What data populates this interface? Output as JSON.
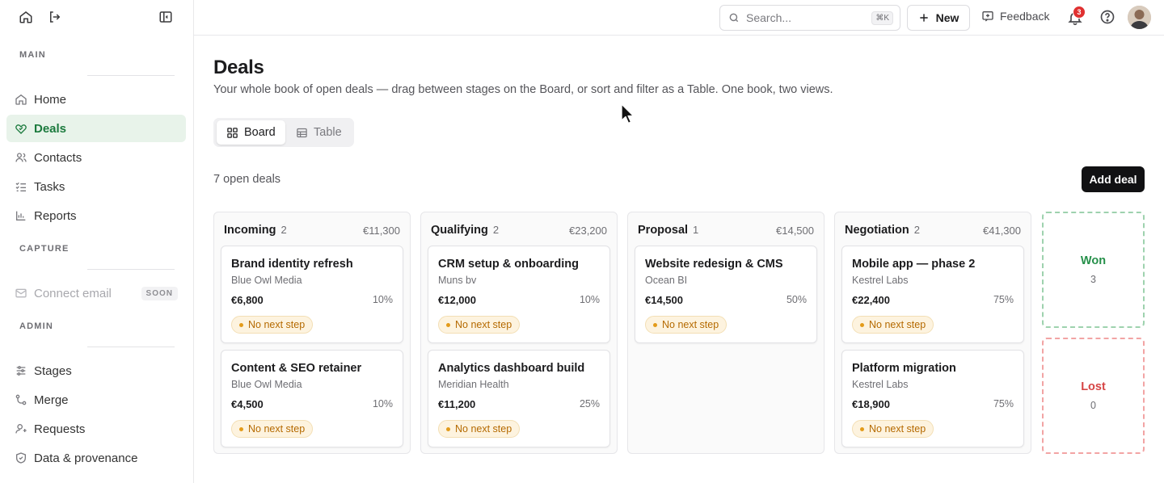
{
  "sidebar": {
    "sections": {
      "main": "MAIN",
      "capture": "CAPTURE",
      "admin": "ADMIN"
    },
    "items": [
      {
        "label": "Home",
        "icon": "home-icon"
      },
      {
        "label": "Deals",
        "icon": "deals-icon",
        "active": true
      },
      {
        "label": "Contacts",
        "icon": "contacts-icon"
      },
      {
        "label": "Tasks",
        "icon": "tasks-icon"
      },
      {
        "label": "Reports",
        "icon": "reports-icon"
      },
      {
        "label": "Connect email",
        "icon": "mail-icon",
        "badge": "SOON",
        "disabled": true
      },
      {
        "label": "Stages",
        "icon": "stages-icon"
      },
      {
        "label": "Merge",
        "icon": "merge-icon"
      },
      {
        "label": "Requests",
        "icon": "requests-icon"
      },
      {
        "label": "Data & provenance",
        "icon": "shield-icon"
      }
    ]
  },
  "topbar": {
    "search_placeholder": "Search...",
    "search_shortcut": "⌘K",
    "new_label": "New",
    "feedback_label": "Feedback",
    "notification_count": "3"
  },
  "page": {
    "title": "Deals",
    "subtitle": "Your whole book of open deals — drag between stages on the Board, or sort and filter as a Table. One book, two views.",
    "views": [
      "Board",
      "Table"
    ],
    "active_view": "Board",
    "open_count": "7 open deals",
    "add_deal_label": "Add deal"
  },
  "board": {
    "columns": [
      {
        "name": "Incoming",
        "count": "2",
        "total": "€11,300",
        "cards": [
          {
            "title": "Brand identity refresh",
            "company": "Blue Owl Media",
            "value": "€6,800",
            "probability": "10%",
            "status": "No next step"
          },
          {
            "title": "Content & SEO retainer",
            "company": "Blue Owl Media",
            "value": "€4,500",
            "probability": "10%",
            "status": "No next step"
          }
        ]
      },
      {
        "name": "Qualifying",
        "count": "2",
        "total": "€23,200",
        "cards": [
          {
            "title": "CRM setup & onboarding",
            "company": "Muns bv",
            "value": "€12,000",
            "probability": "10%",
            "status": "No next step"
          },
          {
            "title": "Analytics dashboard build",
            "company": "Meridian Health",
            "value": "€11,200",
            "probability": "25%",
            "status": "No next step"
          }
        ]
      },
      {
        "name": "Proposal",
        "count": "1",
        "total": "€14,500",
        "cards": [
          {
            "title": "Website redesign & CMS",
            "company": "Ocean BI",
            "value": "€14,500",
            "probability": "50%",
            "status": "No next step"
          }
        ]
      },
      {
        "name": "Negotiation",
        "count": "2",
        "total": "€41,300",
        "cards": [
          {
            "title": "Mobile app — phase 2",
            "company": "Kestrel Labs",
            "value": "€22,400",
            "probability": "75%",
            "status": "No next step"
          },
          {
            "title": "Platform migration",
            "company": "Kestrel Labs",
            "value": "€18,900",
            "probability": "75%",
            "status": "No next step"
          }
        ]
      }
    ],
    "outcomes": {
      "won": {
        "label": "Won",
        "count": "3",
        "color": "#26904a"
      },
      "lost": {
        "label": "Lost",
        "count": "0",
        "color": "#d64545"
      }
    }
  },
  "colors": {
    "accent": "#1b7a3d",
    "active_bg": "#e8f3ea",
    "warning_pill": "#b56a00",
    "primary_button": "#111113",
    "notification": "#e03131"
  }
}
